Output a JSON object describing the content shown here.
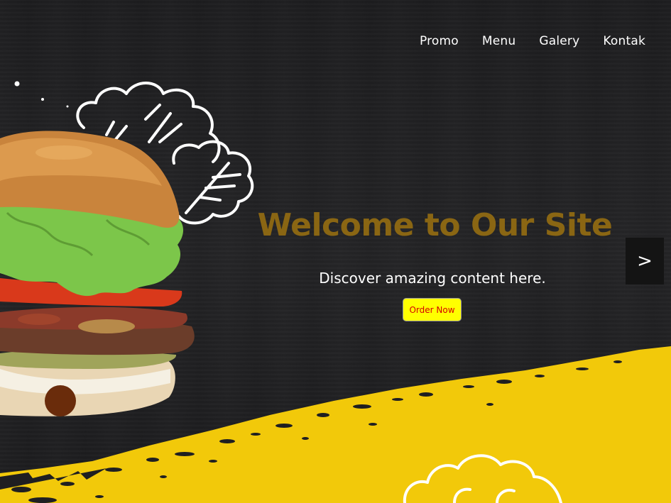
{
  "nav": {
    "items": [
      {
        "label": "Promo"
      },
      {
        "label": "Menu"
      },
      {
        "label": "Galery"
      },
      {
        "label": "Kontak"
      }
    ]
  },
  "hero": {
    "title": "Welcome to Our Site",
    "subtitle": "Discover amazing content here.",
    "cta_label": "Order Now",
    "next_label": ">"
  },
  "colors": {
    "background": "#1f1f21",
    "title": "#8a6613",
    "accent_yellow": "#f2c90a",
    "button_bg": "#ffff00",
    "button_text": "#d40000"
  },
  "icons": {
    "hero_image": "burger-image",
    "decoration_top": "lettuce-outline-icon",
    "decoration_bottom": "cloud-outline-icon"
  }
}
